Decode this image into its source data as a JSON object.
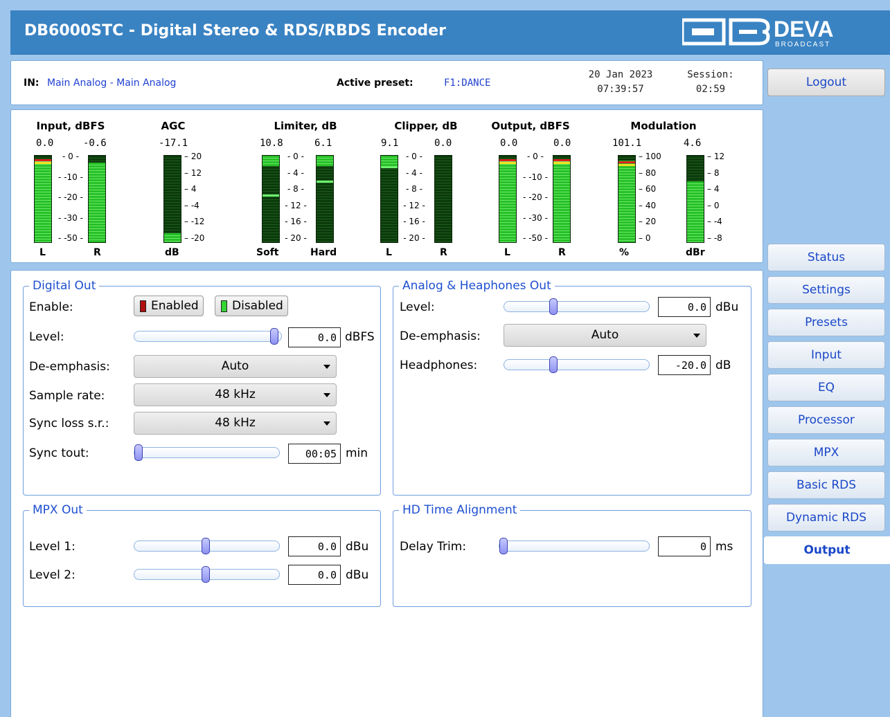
{
  "app": {
    "title": "DB6000STC - Digital Stereo & RDS/RBDS Encoder",
    "logo_text": "DEVA",
    "logo_sub": "BROADCAST"
  },
  "info": {
    "in_label": "IN:",
    "in_value": "Main Analog - Main Analog",
    "preset_label": "Active preset:",
    "preset_value": "F1:DANCE",
    "date": "20 Jan 2023",
    "time": "07:39:57",
    "session_label": "Session:",
    "session_value": "02:59"
  },
  "logout_label": "Logout",
  "meters": {
    "input": {
      "title": "Input, dBFS",
      "val_l": "0.0",
      "val_r": "-0.6",
      "lbl_l": "L",
      "lbl_r": "R",
      "scale": [
        "0",
        "-10",
        "-20",
        "-30",
        "-50"
      ],
      "level_l": 0.96,
      "level_r": 0.92
    },
    "agc": {
      "title": "AGC",
      "val": "-17.1",
      "lbl": "dB",
      "scale": [
        "20",
        "12",
        "4",
        "-4",
        "-12",
        "-20"
      ],
      "level": 0.1
    },
    "limiter": {
      "title": "Limiter, dB",
      "val_l": "10.8",
      "val_r": "6.1",
      "lbl_l": "Soft",
      "lbl_r": "Hard",
      "scale": [
        "0",
        "4",
        "8",
        "12",
        "16",
        "20"
      ],
      "level_l": 0.55,
      "level_r": 0.71
    },
    "clipper": {
      "title": "Clipper, dB",
      "val_l": "9.1",
      "val_r": "0.0",
      "lbl_l": "L",
      "lbl_r": "R",
      "scale": [
        "0",
        "4",
        "8",
        "12",
        "16",
        "20"
      ],
      "level_l": 0.88,
      "level_r": 0.0
    },
    "output": {
      "title": "Output, dBFS",
      "val_l": "0.0",
      "val_r": "0.0",
      "lbl_l": "L",
      "lbl_r": "R",
      "scale": [
        "0",
        "-10",
        "-20",
        "-30",
        "-50"
      ],
      "level_l": 0.96,
      "level_r": 0.96
    },
    "modulation": {
      "title": "Modulation",
      "val_l": "101.1",
      "val_r": "4.6",
      "lbl_l": "%",
      "lbl_r": "dBr",
      "scale_l": [
        "100",
        "80",
        "60",
        "40",
        "20",
        "0"
      ],
      "scale_r": [
        "12",
        "8",
        "4",
        "0",
        "-4",
        "-8"
      ],
      "level_l": 0.94,
      "level_r": 0.7
    }
  },
  "digital_out": {
    "title": "Digital Out",
    "enable_label": "Enable:",
    "enabled_btn": "Enabled",
    "disabled_btn": "Disabled",
    "level_label": "Level:",
    "level_value": "0.0",
    "level_unit": "dBFS",
    "level_pos": 0.98,
    "deemph_label": "De-emphasis:",
    "deemph_value": "Auto",
    "sr_label": "Sample rate:",
    "sr_value": "48 kHz",
    "sync_sr_label": "Sync loss s.r.:",
    "sync_sr_value": "48 kHz",
    "sync_tout_label": "Sync tout:",
    "sync_tout_value": "00:05",
    "sync_tout_unit": "min",
    "sync_tout_pos": 0.0
  },
  "analog_out": {
    "title": "Analog & Heaphones Out",
    "level_label": "Level:",
    "level_value": "0.0",
    "level_unit": "dBu",
    "level_pos": 0.33,
    "deemph_label": "De-emphasis:",
    "deemph_value": "Auto",
    "hp_label": "Headphones:",
    "hp_value": "-20.0",
    "hp_unit": "dB",
    "hp_pos": 0.33
  },
  "mpx_out": {
    "title": "MPX Out",
    "level1_label": "Level 1:",
    "level1_value": "0.0",
    "level1_unit": "dBu",
    "level1_pos": 0.49,
    "level2_label": "Level 2:",
    "level2_value": "0.0",
    "level2_unit": "dBu",
    "level2_pos": 0.49
  },
  "hd_align": {
    "title": "HD Time Alignment",
    "delay_label": "Delay Trim:",
    "delay_value": "0",
    "delay_unit": "ms",
    "delay_pos": 0.0
  },
  "menu": [
    "Status",
    "Settings",
    "Presets",
    "Input",
    "EQ",
    "Processor",
    "MPX",
    "Basic RDS",
    "Dynamic RDS",
    "Output"
  ],
  "active_menu": "Output",
  "colors": {
    "header": "#3a83c3",
    "background": "#9ec6ec",
    "link": "#1a47c8",
    "enabled_led": "#b01010",
    "disabled_led": "#33d433"
  }
}
